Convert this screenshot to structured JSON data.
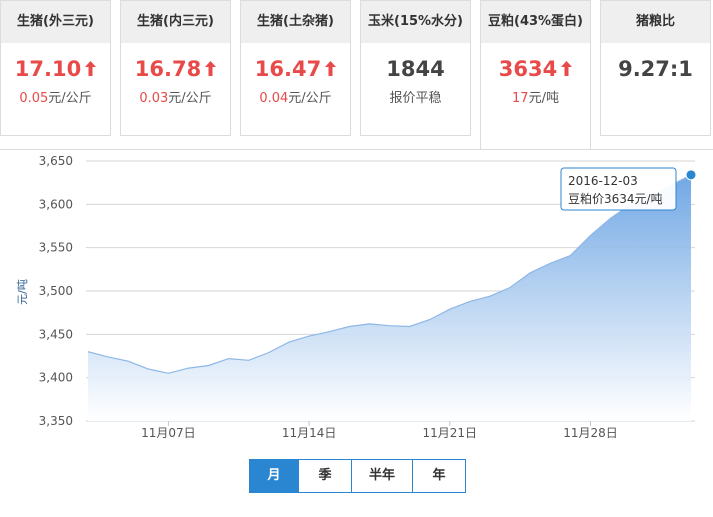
{
  "cards": [
    {
      "title": "生猪(外三元)",
      "value": "17.10",
      "trend": "up",
      "change": "0.05",
      "unit": "元/公斤"
    },
    {
      "title": "生猪(内三元)",
      "value": "16.78",
      "trend": "up",
      "change": "0.03",
      "unit": "元/公斤"
    },
    {
      "title": "生猪(土杂猪)",
      "value": "16.47",
      "trend": "up",
      "change": "0.04",
      "unit": "元/公斤"
    },
    {
      "title": "玉米(15%水分)",
      "value": "1844",
      "note": "报价平稳"
    },
    {
      "title": "豆粕(43%蛋白)",
      "value": "3634",
      "trend": "up",
      "change": "17",
      "unit": "元/吨"
    },
    {
      "title": "猪粮比",
      "value": "9.27:1"
    }
  ],
  "colors": {
    "up": "#e84a4a",
    "accent": "#2a86d1",
    "area_top": "#6aa3e3",
    "area_bottom": "#ffffff"
  },
  "chart_data": {
    "type": "area",
    "ylabel": "元/吨",
    "ylim": [
      3350,
      3650
    ],
    "yticks": [
      3350,
      3400,
      3450,
      3500,
      3550,
      3600,
      3650
    ],
    "yticks_labels": [
      "3,350",
      "3,400",
      "3,450",
      "3,500",
      "3,550",
      "3,600",
      "3,650"
    ],
    "xticks": [
      "11月07日",
      "11月14日",
      "11月21日",
      "11月28日"
    ],
    "grid": true,
    "series": [
      {
        "x": [
          "11-03",
          "11-04",
          "11-05",
          "11-06",
          "11-07",
          "11-08",
          "11-09",
          "11-10",
          "11-11",
          "11-12",
          "11-13",
          "11-14",
          "11-15",
          "11-16",
          "11-17",
          "11-18",
          "11-19",
          "11-20",
          "11-21",
          "11-22",
          "11-23",
          "11-24",
          "11-25",
          "11-26",
          "11-27",
          "11-28",
          "11-29",
          "11-30",
          "12-01",
          "12-02",
          "12-03"
        ],
        "values": [
          3430,
          3424,
          3419,
          3410,
          3405,
          3411,
          3414,
          3422,
          3420,
          3429,
          3441,
          3448,
          3453,
          3459,
          3462,
          3460,
          3459,
          3467,
          3479,
          3488,
          3494,
          3504,
          3521,
          3532,
          3541,
          3564,
          3584,
          3600,
          3610,
          3622,
          3634
        ]
      }
    ],
    "tooltip": {
      "date": "2016-12-03",
      "text": "豆粕价3634元/吨"
    }
  },
  "range_tabs": [
    "月",
    "季",
    "半年",
    "年"
  ]
}
